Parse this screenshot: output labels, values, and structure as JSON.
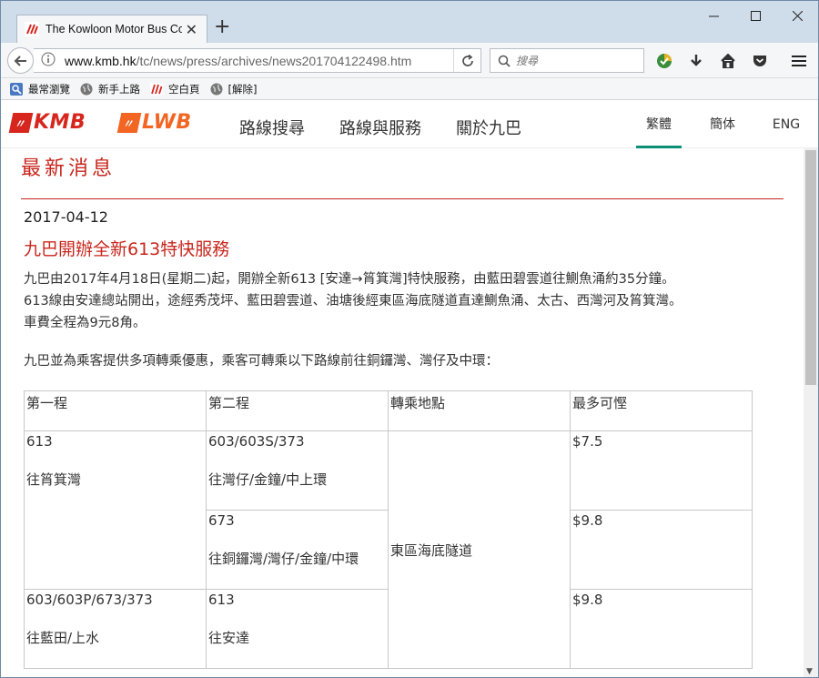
{
  "browser": {
    "tab_title": "The Kowloon Motor Bus Co",
    "url_host": "www.kmb.hk",
    "url_path": "/tc/news/press/archives/news201704122498.htm",
    "search_placeholder": "搜尋",
    "bookmarks": [
      "最常瀏覽",
      "新手上路",
      "空白頁",
      "[解除]"
    ]
  },
  "site": {
    "logo_kmb": "KMB",
    "logo_lwb": "LWB",
    "nav": [
      "路線搜尋",
      "路線與服務",
      "關於九巴"
    ],
    "lang": [
      "繁體",
      "簡体",
      "ENG"
    ],
    "active_lang": "繁體",
    "brand_color": "#c8261d",
    "accent_color": "#0b8f76"
  },
  "article": {
    "section_title": "最新消息",
    "date": "2017-04-12",
    "headline": "九巴開辦全新613特快服務",
    "para1": [
      "九巴由2017年4月18日(星期二)起，開辦全新613 [安達→筲箕灣]特快服務，由藍田碧雲道往鰂魚涌約35分鐘。",
      "613線由安達總站開出，途經秀茂坪、藍田碧雲道、油塘後經東區海底隧道直達鰂魚涌、太古、西灣河及筲箕灣。",
      "車費全程為9元8角。"
    ],
    "para2": "九巴並為乘客提供多項轉乘優惠，乘客可轉乘以下路線前往銅鑼灣、灣仔及中環：",
    "table": {
      "headers": [
        "第一程",
        "第二程",
        "轉乘地點",
        "最多可慳"
      ],
      "interchange": "東區海底隧道",
      "rows": [
        {
          "first_route": "613",
          "first_dest": "往筲箕灣",
          "second_route": "603/603S/373",
          "second_dest": "往灣仔/金鐘/中上環",
          "saving": "$7.5"
        },
        {
          "second_route": "673",
          "second_dest": "往銅鑼灣/灣仔/金鐘/中環",
          "saving": "$9.8"
        },
        {
          "first_route": "603/603P/673/373",
          "first_dest": "往藍田/上水",
          "second_route": "613",
          "second_dest": "往安達",
          "saving": "$9.8"
        }
      ]
    }
  }
}
